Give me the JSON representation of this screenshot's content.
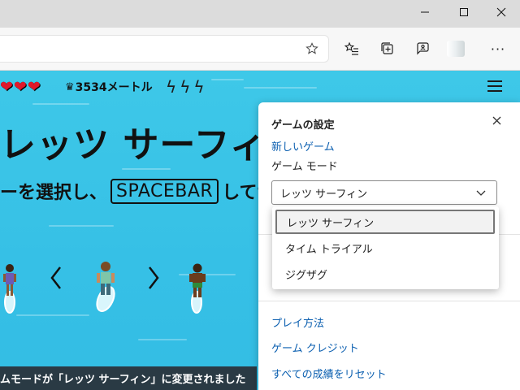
{
  "window": {
    "minimize_icon": "minimize-icon",
    "maximize_icon": "maximize-icon",
    "close_icon": "close-icon"
  },
  "toolbar": {
    "favorite_icon": "star-icon",
    "favorites_icon": "favorites-list-icon",
    "collections_icon": "collections-icon",
    "feedback_icon": "feedback-icon",
    "more_label": "···"
  },
  "game": {
    "hearts": [
      "❤",
      "❤",
      "❤"
    ],
    "crown": "♛",
    "distance": "3534メートル",
    "bolts": [
      "ϟ",
      "ϟ",
      "ϟ"
    ],
    "title": "レッツ サーフィン",
    "instruction_pre": "ーを選択し、",
    "instruction_key": "SPACEBAR",
    "instruction_post": "してサー",
    "toast": "ムモードが「レッツ サーフィン」に変更されました",
    "colors": {
      "sea": "#3ec8e8",
      "heart": "#e0182a",
      "toast_bg": "#2a3a44"
    }
  },
  "settings": {
    "title": "ゲームの設定",
    "new_game": "新しいゲーム",
    "mode_label": "ゲーム モード",
    "mode_selected": "レッツ サーフィン",
    "mode_options": [
      "レッツ サーフィン",
      "タイム トライアル",
      "ジグザグ"
    ],
    "how_to_play": "プレイ方法",
    "credits": "ゲーム クレジット",
    "reset": "すべての成績をリセット",
    "colors": {
      "link": "#0b5fb0"
    }
  }
}
